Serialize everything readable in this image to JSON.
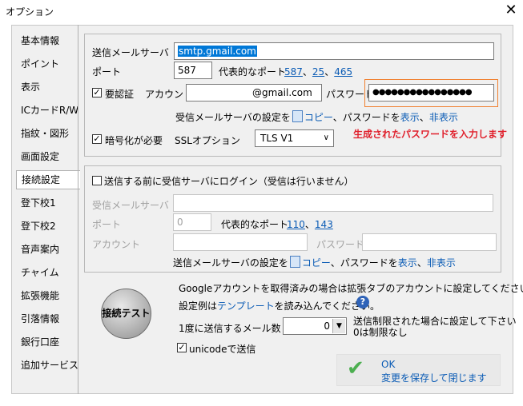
{
  "window": {
    "title": "オプション",
    "close_icon": "close-icon"
  },
  "sidebar": {
    "items": [
      {
        "label": "基本情報"
      },
      {
        "label": "ポイント"
      },
      {
        "label": "表示"
      },
      {
        "label": "ICカードR/W"
      },
      {
        "label": "指紋・図形"
      },
      {
        "label": "画面設定"
      },
      {
        "label": "接続設定",
        "active": true
      },
      {
        "label": "登下校1"
      },
      {
        "label": "登下校2"
      },
      {
        "label": "音声案内"
      },
      {
        "label": "チャイム"
      },
      {
        "label": "拡張機能"
      },
      {
        "label": "引落情報"
      },
      {
        "label": "銀行口座"
      },
      {
        "label": "追加サービス"
      }
    ]
  },
  "smtp": {
    "server_label": "送信メールサーバ",
    "server_value": "smtp.gmail.com",
    "port_label": "ポート",
    "port_value": "587",
    "port_hint": "代表的なポート",
    "port_links": [
      "587",
      "25",
      "465"
    ],
    "port_sep": "、",
    "auth_label": "要認証",
    "account_label": "アカウント",
    "account_value": "@gmail.com",
    "password_label": "パスワード",
    "password_value": "●●●●●●●●●●●●●●●●",
    "copy_text_pre": "受信メールサーバの設定を",
    "copy_link": "コピー",
    "copy_text_mid": "、パスワードを",
    "show_link": "表示",
    "hide_link": "非表示",
    "encrypt_label": "暗号化が必要",
    "ssl_label": "SSLオプション",
    "ssl_value": "TLS V1",
    "annotation": "生成されたパスワードを入力します"
  },
  "pop": {
    "login_label": "送信する前に受信サーバにログイン（受信は行いません）",
    "server_label": "受信メールサーバ",
    "port_label": "ポート",
    "port_value": "0",
    "port_hint": "代表的なポート",
    "port_links": [
      "110",
      "143"
    ],
    "account_label": "アカウント",
    "password_label": "パスワード",
    "copy_text_pre": "送信メールサーバの設定を",
    "copy_link": "コピー",
    "copy_text_mid": "、パスワードを",
    "show_link": "表示",
    "hide_link": "非表示"
  },
  "bottom": {
    "test_button": "接続テスト",
    "google_note": "Googleアカウントを取得済みの場合は拡張タブのアカウントに設定してください",
    "template_pre": "設定例は",
    "template_link": "テンプレート",
    "template_post": "を読み込んでください。",
    "per_send_label": "1度に送信するメール数",
    "per_send_value": "0",
    "limit_note_1": "送信制限された場合に設定して下さい",
    "limit_note_2": "0は制限なし",
    "unicode_label": "unicodeで送信",
    "ok_label": "OK",
    "save_close_label": "変更を保存して閉じます"
  }
}
